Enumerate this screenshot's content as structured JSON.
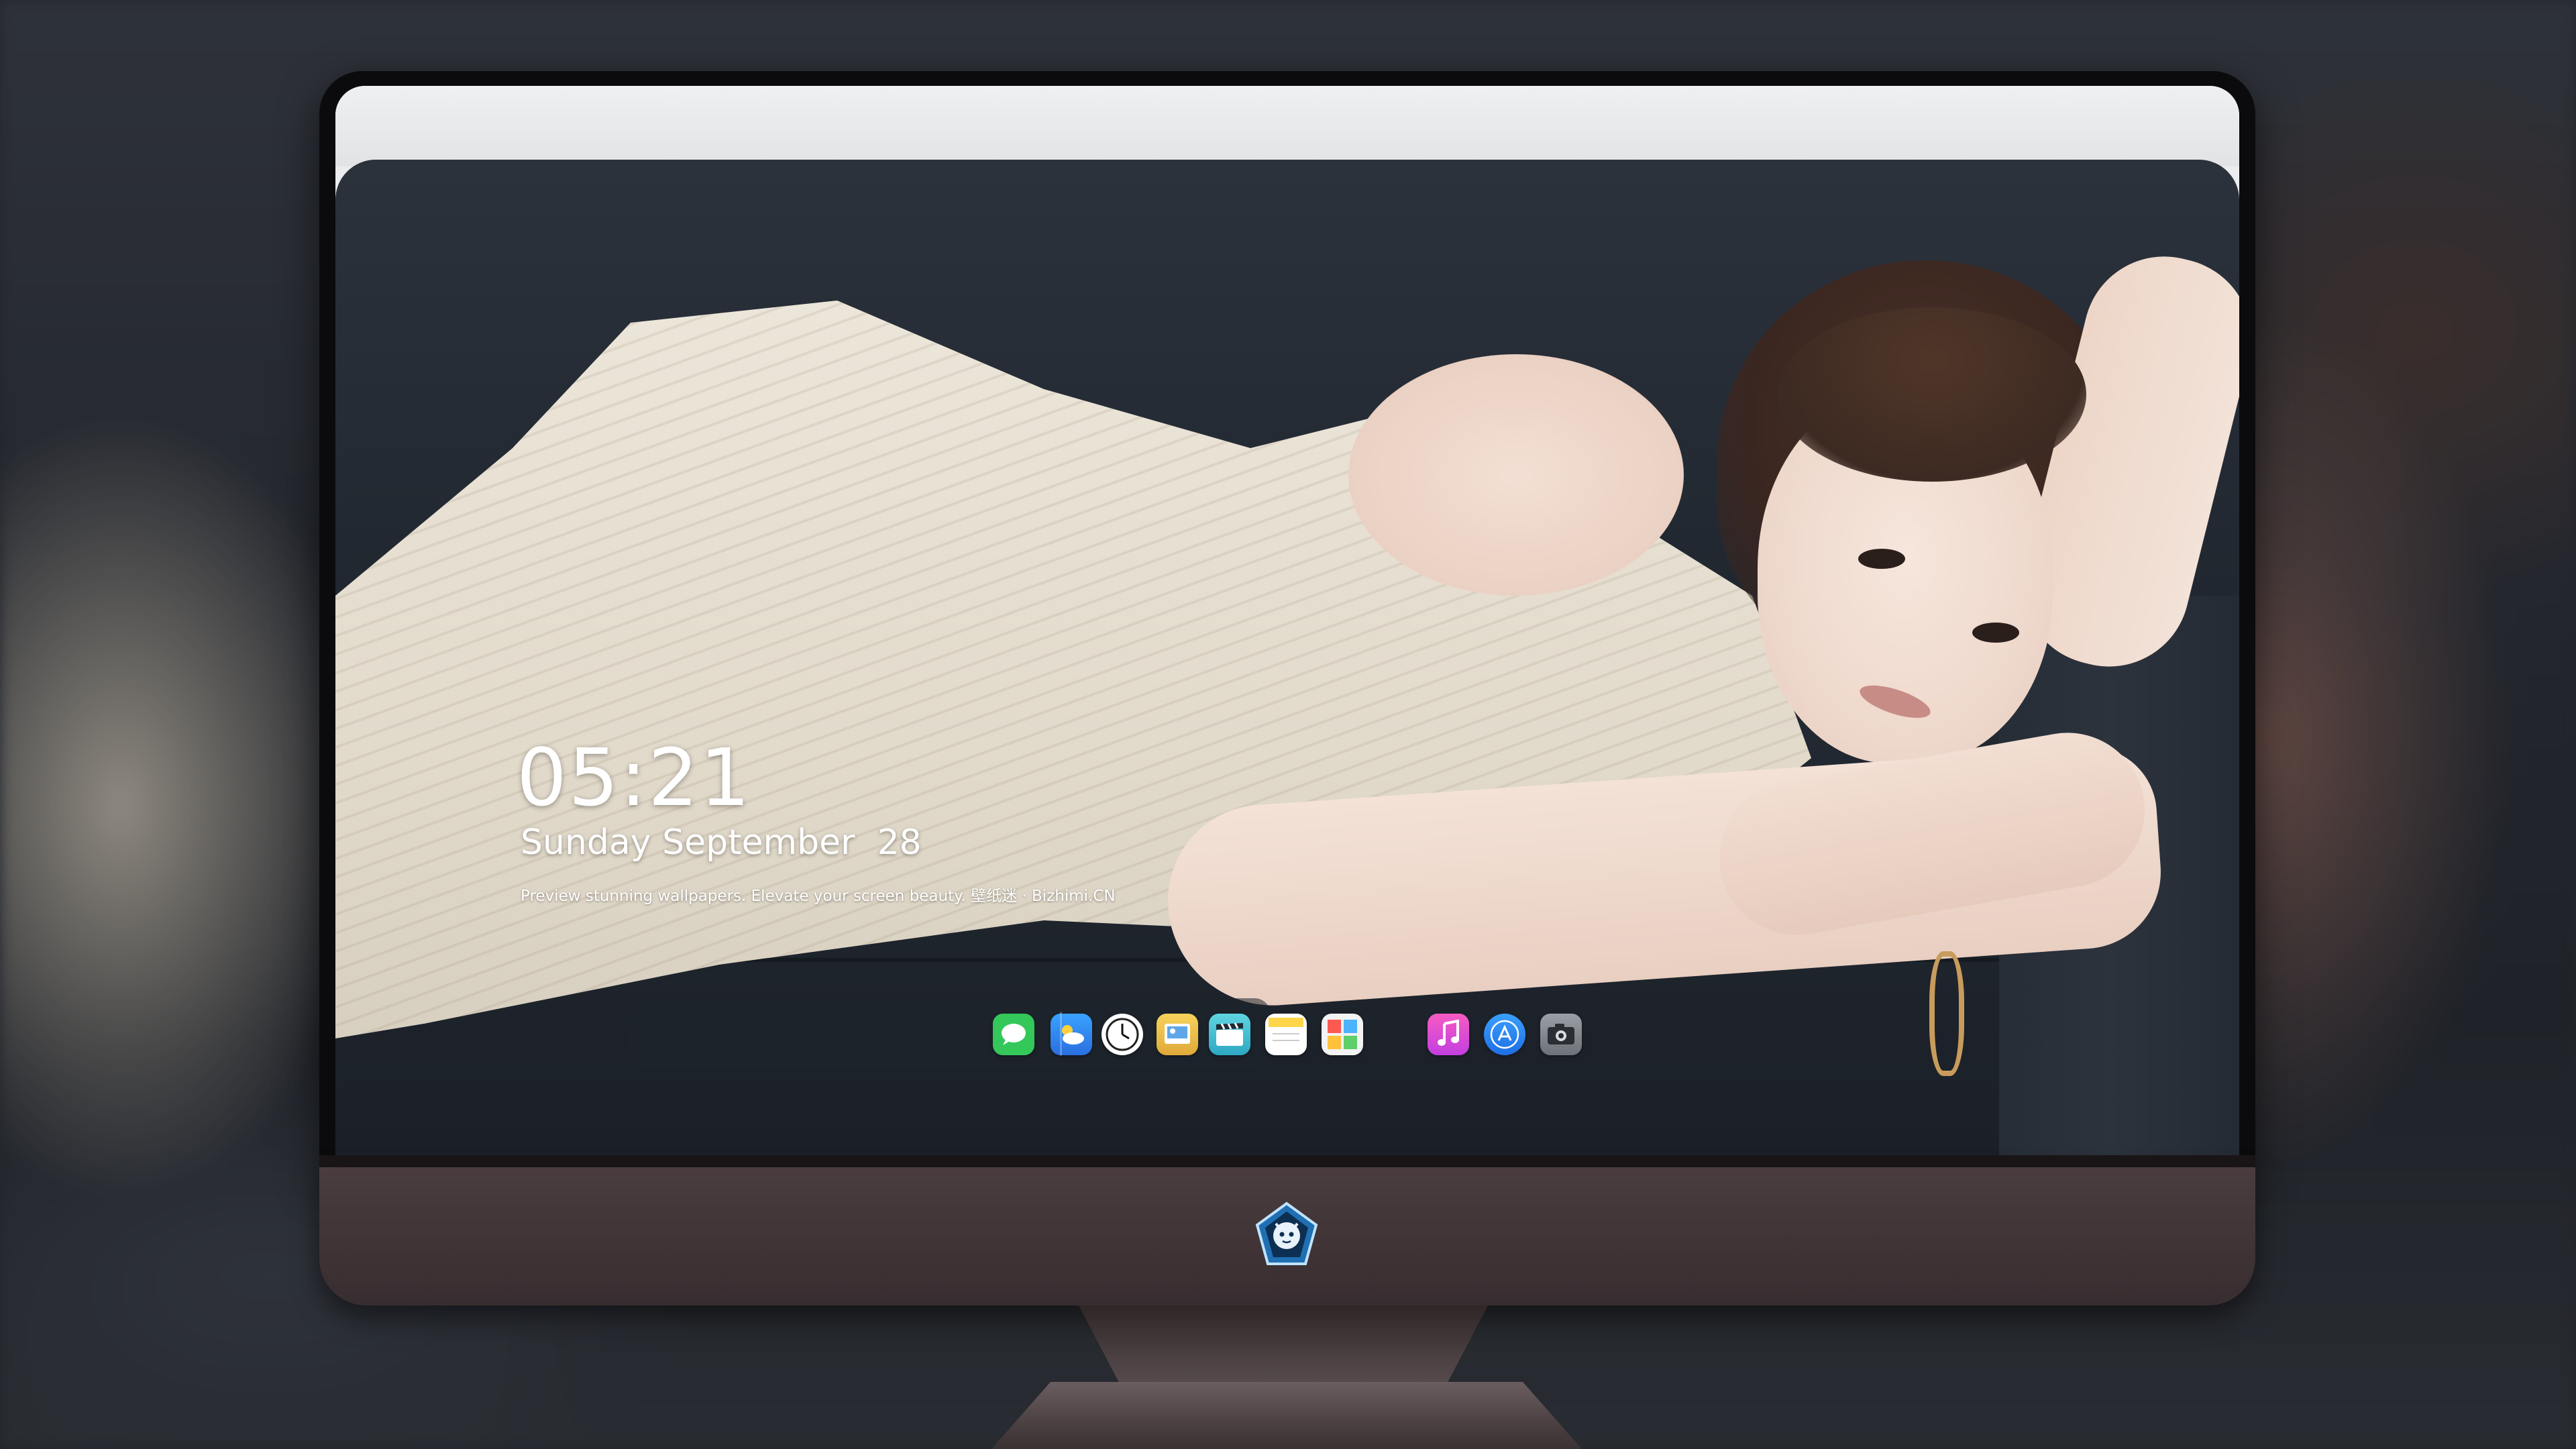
{
  "lockscreen": {
    "time": "05:21",
    "date": "Sunday September  28",
    "tagline": "Preview stunning wallpapers. Elevate your screen beauty. 壁纸迷 · Bizhimi.CN"
  },
  "dock": {
    "apps": [
      {
        "name": "messages-icon",
        "color": "#34c759"
      },
      {
        "name": "weather-icon",
        "color": "#3a8ef0"
      },
      {
        "name": "clock-icon",
        "color": "#ffffff"
      },
      {
        "name": "preview-icon",
        "color": "#f1c64a"
      },
      {
        "name": "clips-icon",
        "color": "#4fc6d8"
      },
      {
        "name": "notes-icon",
        "color": "#ffd54a"
      },
      {
        "name": "photo-booth-icon",
        "color": "#f4f4f4"
      },
      {
        "name": "music-icon",
        "color": "#e94fb5"
      },
      {
        "name": "app-store-icon",
        "color": "#2f8df5"
      },
      {
        "name": "camera-icon",
        "color": "#8d9096"
      }
    ]
  },
  "colors": {
    "text": "#ffffff",
    "chin": "#3f3335",
    "bezel": "#0b0b0d"
  }
}
